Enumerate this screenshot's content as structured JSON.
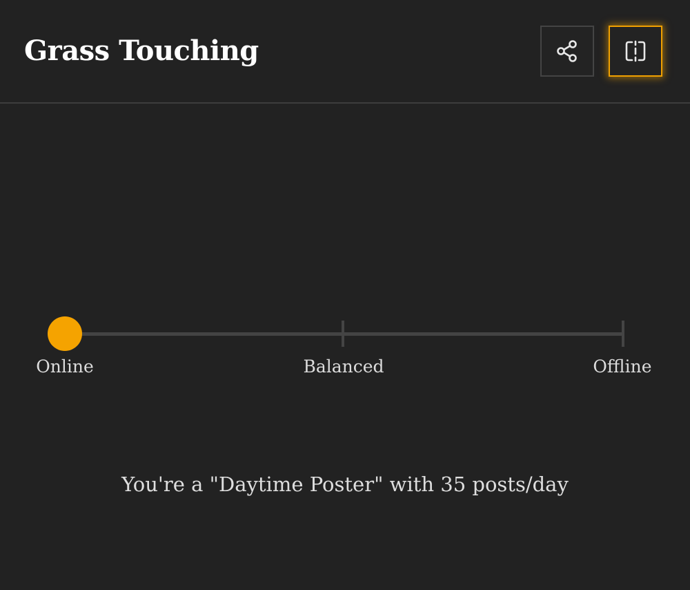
{
  "header": {
    "title": "Grass Touching",
    "share_icon": "share-icon",
    "split_icon": "split-view-icon",
    "accent_color": "#f0a000"
  },
  "slider": {
    "labels": [
      "Online",
      "Balanced",
      "Offline"
    ],
    "value_fraction": 0,
    "thumb_color": "#f5a300",
    "track_color": "#444444"
  },
  "result": {
    "text": "You're a \"Daytime Poster\" with 35 posts/day"
  }
}
